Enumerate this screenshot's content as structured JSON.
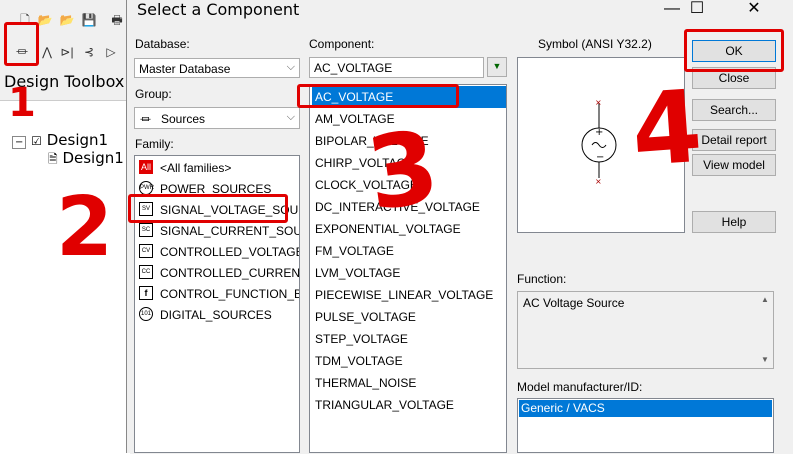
{
  "app": {
    "toolbox_title": "Design Toolbox",
    "tree": [
      {
        "label": "Design1"
      },
      {
        "label": "Design1"
      }
    ]
  },
  "dialog": {
    "title": "Select a Component",
    "minimize": "—",
    "maximize": "☐",
    "close": "✕",
    "database_label": "Database:",
    "database_value": "Master Database",
    "group_label": "Group:",
    "group_value": "Sources",
    "family_label": "Family:",
    "families": [
      {
        "label": "<All families>",
        "icon": "All"
      },
      {
        "label": "POWER_SOURCES",
        "icon": "PWR"
      },
      {
        "label": "SIGNAL_VOLTAGE_SOU",
        "icon": "SV"
      },
      {
        "label": "SIGNAL_CURRENT_SOU",
        "icon": "SC"
      },
      {
        "label": "CONTROLLED_VOLTAGE",
        "icon": "CV"
      },
      {
        "label": "CONTROLLED_CURRENT",
        "icon": "CC"
      },
      {
        "label": "CONTROL_FUNCTION_B",
        "icon": "f"
      },
      {
        "label": "DIGITAL_SOURCES",
        "icon": "101"
      }
    ],
    "component_label": "Component:",
    "component_value": "AC_VOLTAGE",
    "components": [
      "AC_VOLTAGE",
      "AM_VOLTAGE",
      "BIPOLAR_VOLTAGE",
      "CHIRP_VOLTAGE",
      "CLOCK_VOLTAGE",
      "DC_INTERACTIVE_VOLTAGE",
      "EXPONENTIAL_VOLTAGE",
      "FM_VOLTAGE",
      "LVM_VOLTAGE",
      "PIECEWISE_LINEAR_VOLTAGE",
      "PULSE_VOLTAGE",
      "STEP_VOLTAGE",
      "TDM_VOLTAGE",
      "THERMAL_NOISE",
      "TRIANGULAR_VOLTAGE"
    ],
    "symbol_label": "Symbol (ANSI Y32.2)",
    "buttons": {
      "ok": "OK",
      "close": "Close",
      "search": "Search...",
      "detail": "Detail report",
      "view_model": "View model",
      "help": "Help"
    },
    "function_label": "Function:",
    "function_value": "AC Voltage Source",
    "model_label": "Model manufacturer/ID:",
    "model_value": "Generic / VACS"
  },
  "annotations": [
    "1",
    "2",
    "3",
    "4"
  ],
  "colors": {
    "accent": "#0078d7",
    "annotation": "#e00000"
  }
}
